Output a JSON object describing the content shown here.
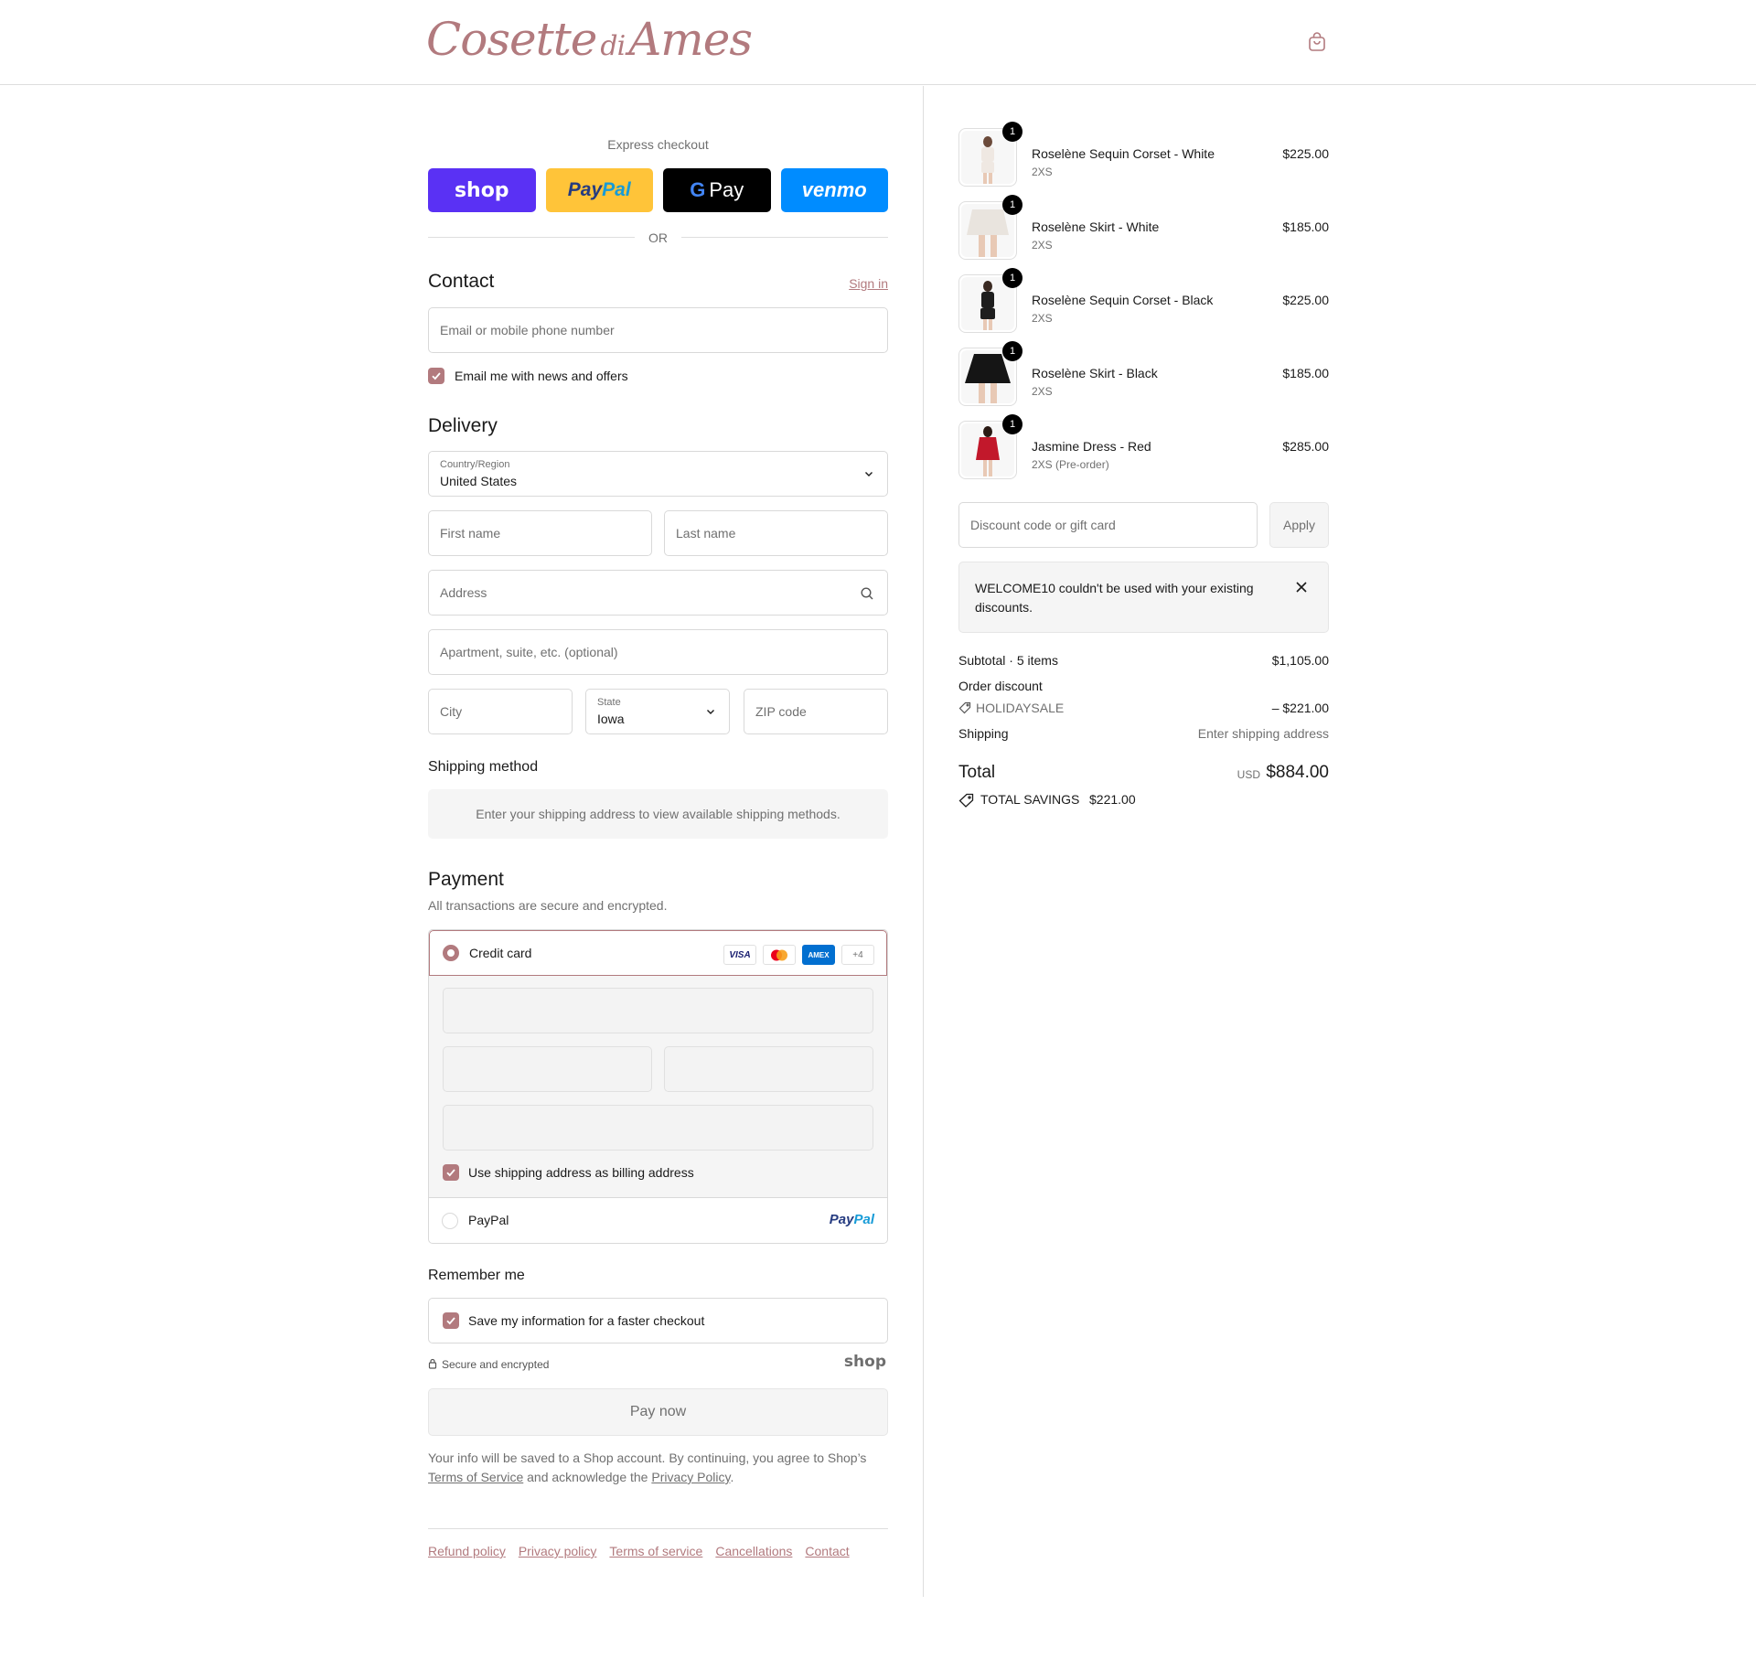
{
  "header": {
    "logo_text": "Cosette",
    "logo_di": "di",
    "logo_text2": "Ames"
  },
  "express": {
    "title": "Express checkout",
    "shop_label": "shop",
    "paypal_label_1": "Pay",
    "paypal_label_2": "Pal",
    "gpay_g": "G",
    "gpay_label": "Pay",
    "venmo_label": "venmo",
    "or_text": "OR"
  },
  "contact": {
    "heading": "Contact",
    "sign_in": "Sign in",
    "email_placeholder": "Email or mobile phone number",
    "news_label": "Email me with news and offers"
  },
  "delivery": {
    "heading": "Delivery",
    "country_label": "Country/Region",
    "country_value": "United States",
    "first_name": "First name",
    "last_name": "Last name",
    "address": "Address",
    "apartment": "Apartment, suite, etc. (optional)",
    "city": "City",
    "state_label": "State",
    "state_value": "Iowa",
    "zip": "ZIP code"
  },
  "shipping_method": {
    "heading": "Shipping method",
    "message": "Enter your shipping address to view available shipping methods."
  },
  "payment": {
    "heading": "Payment",
    "subtitle": "All transactions are secure and encrypted.",
    "credit_card_label": "Credit card",
    "cards": [
      "VISA",
      "",
      "AMEX",
      "+4"
    ],
    "billing_label": "Use shipping address as billing address",
    "paypal_label": "PayPal",
    "paypal_logo_1": "Pay",
    "paypal_logo_2": "Pal"
  },
  "remember": {
    "heading": "Remember me",
    "save_label": "Save my information for a faster checkout",
    "secure_label": "Secure and encrypted",
    "shop_logo": "shop"
  },
  "pay_now": "Pay now",
  "disclaimer": {
    "text_1": "Your info will be saved to a Shop account. By continuing, you agree to Shop’s ",
    "terms_link": "Terms of Service",
    "text_2": " and acknowledge the ",
    "privacy_link": "Privacy Policy",
    "text_3": "."
  },
  "footer": {
    "links": [
      "Refund policy",
      "Privacy policy",
      "Terms of service",
      "Cancellations",
      "Contact"
    ]
  },
  "summary": {
    "items": [
      {
        "name": "Roselène Sequin Corset - White",
        "variant": "2XS",
        "price": "$225.00",
        "qty": "1",
        "color": "#efe8e2"
      },
      {
        "name": "Roselène Skirt - White",
        "variant": "2XS",
        "price": "$185.00",
        "qty": "1",
        "color": "#e9e4de"
      },
      {
        "name": "Roselène Sequin Corset - Black",
        "variant": "2XS",
        "price": "$225.00",
        "qty": "1",
        "color": "#1e1e1e"
      },
      {
        "name": "Roselène Skirt - Black",
        "variant": "2XS",
        "price": "$185.00",
        "qty": "1",
        "color": "#151515"
      },
      {
        "name": "Jasmine Dress - Red",
        "variant": "2XS (Pre-order)",
        "price": "$285.00",
        "qty": "1",
        "color": "#c2182b"
      }
    ],
    "discount_placeholder": "Discount code or gift card",
    "apply_label": "Apply",
    "notice": "WELCOME10 couldn't be used with your existing discounts.",
    "subtotal_label": "Subtotal · 5 items",
    "subtotal_value": "$1,105.00",
    "order_discount_label": "Order discount",
    "discount_code": "HOLIDAYSALE",
    "discount_value": "– $221.00",
    "shipping_label": "Shipping",
    "shipping_value": "Enter shipping address",
    "total_label": "Total",
    "currency": "USD",
    "total_value": "$884.00",
    "savings_label": "TOTAL SAVINGS",
    "savings_value": "$221.00"
  },
  "colors": {
    "accent": "#b27a7e",
    "shop": "#5a31f4",
    "paypal": "#ffc439",
    "venmo": "#008cff"
  }
}
